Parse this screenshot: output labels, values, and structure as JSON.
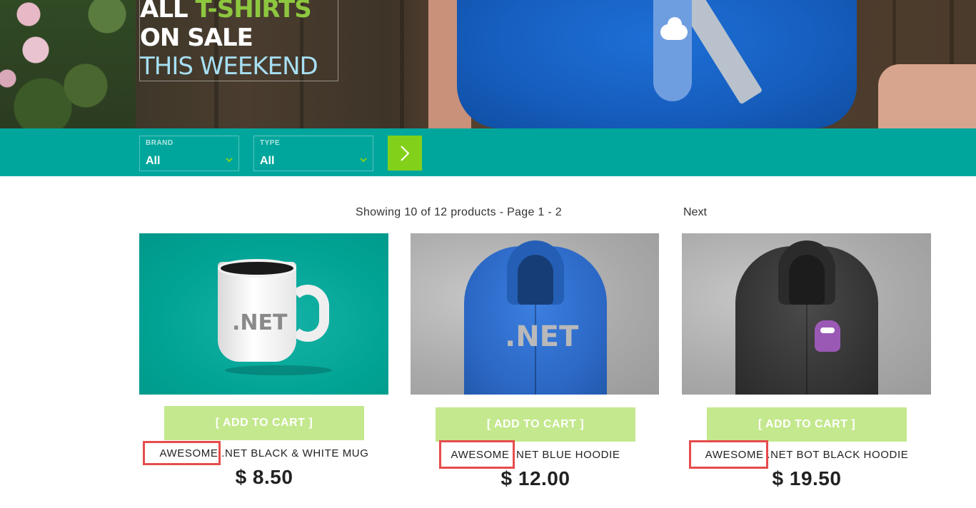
{
  "hero": {
    "line1_a": "ALL ",
    "line1_b": "T-SHIRTS",
    "line2": "ON SALE",
    "line3": "THIS WEEKEND"
  },
  "filters": {
    "brand": {
      "label": "BRAND",
      "value": "All"
    },
    "type": {
      "label": "TYPE",
      "value": "All"
    }
  },
  "catalog": {
    "showing": "Showing 10 of 12 products - Page 1 - 2",
    "next": "Next",
    "add_to_cart": "[ ADD TO CART ]",
    "products": [
      {
        "highlight": "AWESOME",
        "name_rest": " .NET BLACK & WHITE MUG",
        "price": "$ 8.50"
      },
      {
        "highlight": "AWESOME",
        "name_rest": " .NET BLUE HOODIE",
        "price": "$ 12.00"
      },
      {
        "highlight": "AWESOME",
        "name_rest": " .NET BOT BLACK HOODIE",
        "price": "$ 19.50"
      }
    ]
  },
  "product_images": {
    "mug_text": ".NET",
    "hoodie_text": ".NET"
  },
  "colors": {
    "accent_teal": "#00a69c",
    "go_button": "#83d01b",
    "cart_button": "#c4e88e",
    "highlight_box": "#e64c4c",
    "hero_accent": "#8dc63f"
  },
  "icons": {
    "go": "chevron-right-icon",
    "select": "chevron-down-icon"
  }
}
